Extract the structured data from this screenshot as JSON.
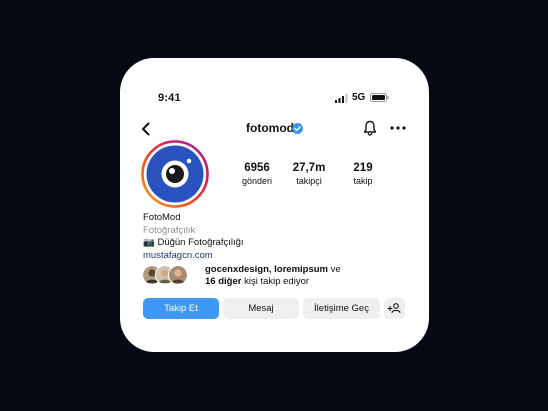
{
  "status_bar": {
    "time": "9:41",
    "network": "5G"
  },
  "header": {
    "username": "fotomod"
  },
  "stats": [
    {
      "value": "6956",
      "label": "gönderi"
    },
    {
      "value": "27,7m",
      "label": "takipçi"
    },
    {
      "value": "219",
      "label": "takip"
    }
  ],
  "bio": {
    "name": "FotoMod",
    "category": "Fotoğrafçılık",
    "line": "📷 Düğün Fotoğrafçılığı",
    "link": "mustafagcn.com"
  },
  "followed_by": {
    "names": "gocenxdesign, loremipsum",
    "connector": " ve",
    "others": "16 diğer",
    "suffix": " kişi takip ediyor"
  },
  "actions": {
    "follow": "Takip Et",
    "message": "Mesaj",
    "contact": "İletişime Geç"
  },
  "colors": {
    "background": "#050914",
    "accent": "#3e97f5",
    "verified": "#3897f0",
    "link": "#1b3a6b",
    "avatar_bg": "#2a52be"
  },
  "icons": [
    "back-arrow-icon",
    "verified-badge-icon",
    "bell-icon",
    "more-options-icon",
    "add-person-icon",
    "signal-icon",
    "battery-icon"
  ]
}
